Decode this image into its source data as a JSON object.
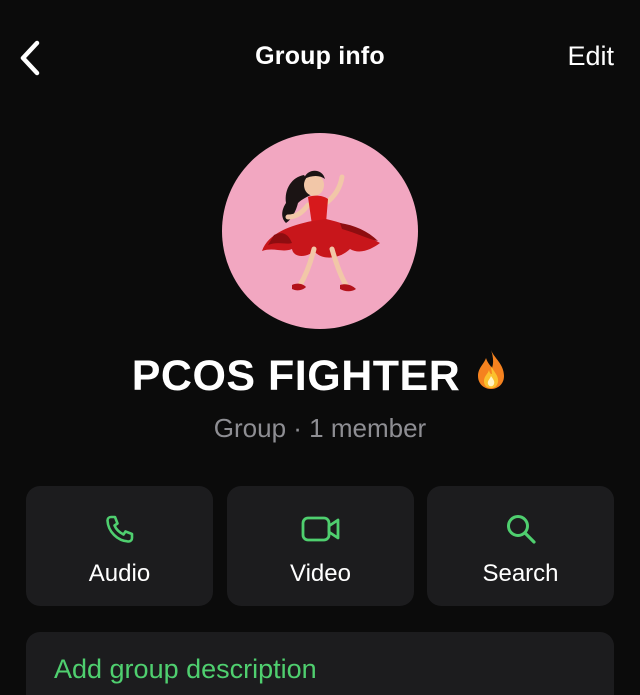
{
  "header": {
    "back_icon": "chevron-left-icon",
    "title": "Group info",
    "edit_label": "Edit"
  },
  "profile": {
    "avatar_icon": "dancing-woman-emoji",
    "avatar_bg": "#f2a7c1",
    "name": "PCOS FIGHTER",
    "name_emoji": "fire-emoji",
    "subtitle": "Group · 1 member"
  },
  "actions": [
    {
      "label": "Audio",
      "icon": "phone-icon"
    },
    {
      "label": "Video",
      "icon": "video-camera-icon"
    },
    {
      "label": "Search",
      "icon": "search-icon"
    }
  ],
  "description": {
    "label": "Add group description"
  },
  "colors": {
    "background": "#0b0b0b",
    "card": "#1c1c1e",
    "accent_green": "#4fcf6f",
    "secondary_text": "#8e8e93"
  }
}
